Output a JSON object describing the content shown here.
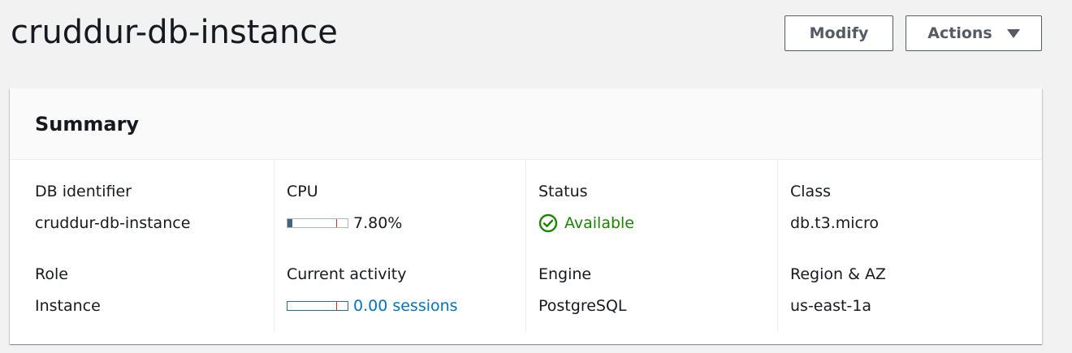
{
  "header": {
    "title": "cruddur-db-instance",
    "modify_label": "Modify",
    "actions_label": "Actions"
  },
  "summary": {
    "title": "Summary",
    "db_identifier": {
      "label": "DB identifier",
      "value": "cruddur-db-instance"
    },
    "role": {
      "label": "Role",
      "value": "Instance"
    },
    "cpu": {
      "label": "CPU",
      "value": "7.80%",
      "fill_percent": 7.8
    },
    "current_activity": {
      "label": "Current activity",
      "value": "0.00 sessions",
      "fill_percent": 0
    },
    "status": {
      "label": "Status",
      "value": "Available",
      "icon": "check-circle-icon"
    },
    "engine": {
      "label": "Engine",
      "value": "PostgreSQL"
    },
    "class": {
      "label": "Class",
      "value": "db.t3.micro"
    },
    "region_az": {
      "label": "Region & AZ",
      "value": "us-east-1a"
    }
  },
  "colors": {
    "status_available": "#1d8102",
    "link": "#0073bb",
    "meter_fill": "#44647e",
    "meter_threshold": "#d13212",
    "button_border": "#545b64"
  }
}
